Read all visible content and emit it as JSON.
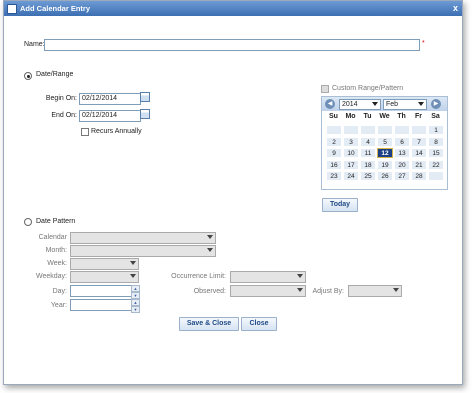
{
  "window": {
    "title": "Add Calendar Entry",
    "close_glyph": "x"
  },
  "name": {
    "label": "Name:",
    "value": "",
    "required_mark": "*"
  },
  "date_range": {
    "option_label": "Date/Range",
    "begin_label": "Begin On:",
    "begin_value": "02/12/2014",
    "end_label": "End On:",
    "end_value": "02/12/2014",
    "recurs_label": "Recurs Annually"
  },
  "custom_range": {
    "label": "Custom Range/Pattern"
  },
  "calendar": {
    "year": "2014",
    "month": "Feb",
    "weekdays": [
      "Su",
      "Mo",
      "Tu",
      "We",
      "Th",
      "Fr",
      "Sa"
    ],
    "weeks": [
      [
        "",
        "",
        "",
        "",
        "",
        "",
        "1"
      ],
      [
        "2",
        "3",
        "4",
        "5",
        "6",
        "7",
        "8"
      ],
      [
        "9",
        "10",
        "11",
        "12",
        "13",
        "14",
        "15"
      ],
      [
        "16",
        "17",
        "18",
        "19",
        "20",
        "21",
        "22"
      ],
      [
        "23",
        "24",
        "25",
        "26",
        "27",
        "28",
        ""
      ]
    ],
    "selected_day": "12",
    "today_label": "Today"
  },
  "date_pattern": {
    "option_label": "Date Pattern",
    "calendar_label": "Calendar",
    "month_label": "Month:",
    "week_label": "Week:",
    "weekday_label": "Weekday:",
    "occurrence_label": "Occurrence Limit:",
    "day_label": "Day:",
    "observed_label": "Observed:",
    "adjust_label": "Adjust By:",
    "year_label": "Year:"
  },
  "buttons": {
    "save_close": "Save & Close",
    "close": "Close"
  }
}
